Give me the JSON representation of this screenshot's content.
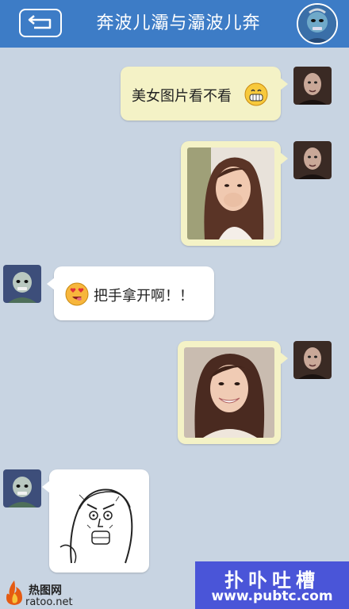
{
  "header": {
    "title": "奔波儿灞与灞波儿奔",
    "back_icon": "back-arrow-icon",
    "bg_color": "#3d7cc6"
  },
  "messages": [
    {
      "id": 1,
      "side": "out",
      "type": "text",
      "text": "美女图片看不看",
      "emoji": "grin-emoji"
    },
    {
      "id": 2,
      "side": "out",
      "type": "image",
      "description": "photo"
    },
    {
      "id": 3,
      "side": "in",
      "type": "text",
      "text": "把手拿开啊！！",
      "emoji": "heart-eyes-emoji"
    },
    {
      "id": 4,
      "side": "out",
      "type": "image",
      "description": "photo"
    },
    {
      "id": 5,
      "side": "in",
      "type": "image",
      "description": "meme"
    }
  ],
  "watermarks": {
    "left_line1": "热图网",
    "left_line2": "ratoo.net",
    "right_line1": "扑卟吐槽",
    "right_line2": "www.pubtc.com"
  }
}
